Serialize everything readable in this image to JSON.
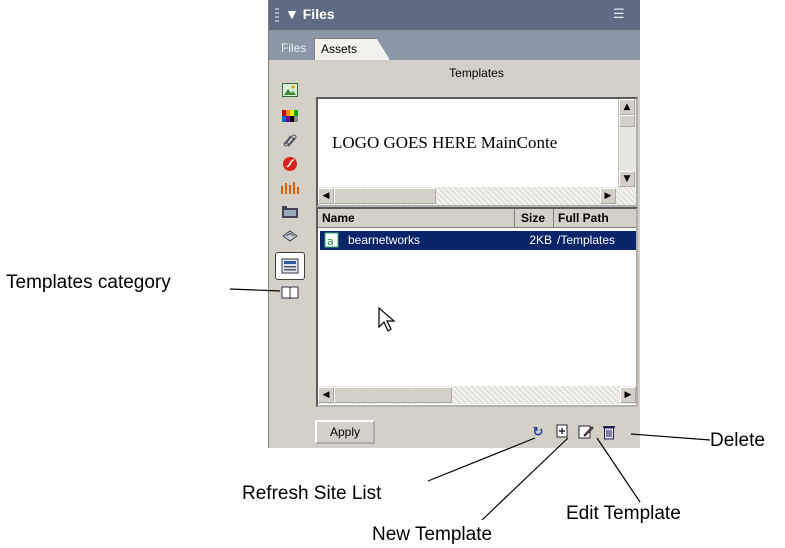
{
  "panel": {
    "title": "Files",
    "collapse_glyph": "▼",
    "tabs": [
      "Files",
      "Assets"
    ],
    "section_title": "Templates",
    "preview_text": "LOGO GOES HERE MainConte",
    "list": {
      "columns": [
        "Name",
        "Size",
        "Full Path"
      ],
      "rows": [
        {
          "name": "bearnetworks",
          "size": "2KB",
          "path": "/Templates"
        }
      ]
    },
    "apply_label": "Apply",
    "category_icons": [
      "images-icon",
      "colors-icon",
      "urls-icon",
      "flash-icon",
      "shockwave-icon",
      "movies-icon",
      "scripts-icon",
      "templates-icon",
      "library-icon"
    ],
    "toolbar_icons": [
      "refresh-icon",
      "new-template-icon",
      "edit-template-icon",
      "delete-icon"
    ]
  },
  "callouts": {
    "templates_category": "Templates category",
    "delete": "Delete",
    "refresh": "Refresh Site List",
    "edit": "Edit Template",
    "new": "New Template"
  }
}
